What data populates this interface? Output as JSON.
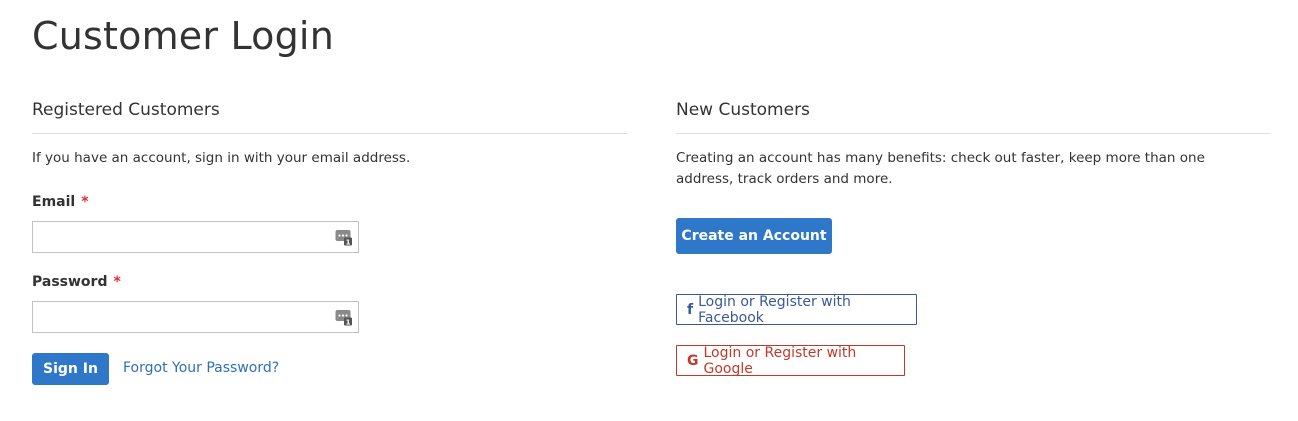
{
  "page": {
    "title": "Customer Login"
  },
  "registered": {
    "title": "Registered Customers",
    "note": "If you have an account, sign in with your email address.",
    "email_label": "Email",
    "email_value": "",
    "password_label": "Password",
    "password_value": "",
    "required_mark": "*",
    "sign_in_label": "Sign In",
    "forgot_label": "Forgot Your Password?"
  },
  "new_customers": {
    "title": "New Customers",
    "note": "Creating an account has many benefits: check out faster, keep more than one address, track orders and more.",
    "create_label": "Create an Account",
    "facebook_label": "Login or Register with Facebook",
    "facebook_icon_glyph": "f",
    "google_label": "Login or Register with Google",
    "google_icon_glyph": "G"
  },
  "colors": {
    "primary": "#2f78c9",
    "link": "#2f6fb9",
    "required": "#e02b27",
    "facebook": "#3b5998",
    "google": "#c0392b"
  },
  "icons": {
    "email_field_icon": "password-manager-icon",
    "password_field_icon": "password-manager-icon",
    "facebook_icon": "facebook-icon",
    "google_icon": "google-icon"
  }
}
